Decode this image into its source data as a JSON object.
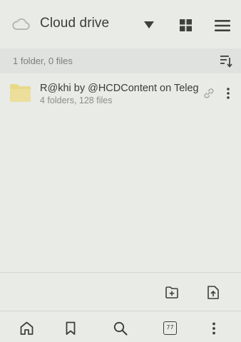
{
  "header": {
    "title": "Cloud drive",
    "icons": {
      "cloud": "cloud-icon",
      "dropdown": "caret-down-icon",
      "view": "grid-view-icon",
      "menu": "hamburger-menu-icon"
    }
  },
  "info_bar": {
    "summary": "1 folder, 0 files",
    "sort_icon": "sort-icon"
  },
  "items": [
    {
      "name": "R@khi by @HCDContent on Teleg...",
      "details": "4 folders, 128 files",
      "icon": "folder-icon",
      "shared_link": true
    }
  ],
  "actions": {
    "new_folder_icon": "new-folder-icon",
    "upload_icon": "upload-icon"
  },
  "bottom_nav": {
    "tab_count": "77",
    "items": [
      "home-icon",
      "bookmark-icon",
      "search-icon",
      "tabs-icon",
      "more-vertical-icon"
    ]
  },
  "colors": {
    "background": "#e9ebe7",
    "info_bar": "#dfe2de",
    "folder": "#e9d98d",
    "text_primary": "#3a3c3a",
    "text_secondary": "#8a8d8a"
  }
}
